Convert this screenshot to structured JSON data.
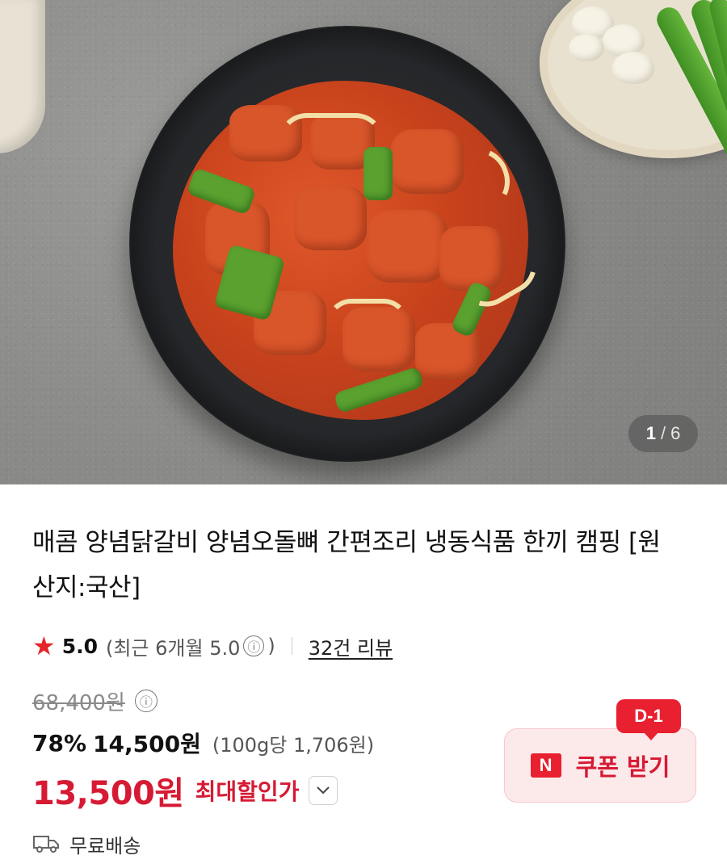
{
  "gallery": {
    "current": "1",
    "separator": "/",
    "total": "6",
    "image_alt": "매콤 양념닭갈비 음식 사진"
  },
  "product": {
    "title": "매콤 양념닭갈비 양념오돌뼈 간편조리 냉동식품 한끼 캠핑 [원산지:국산]"
  },
  "rating": {
    "star_icon": "star-icon",
    "score": "5.0",
    "recent_prefix": "(최근 6개월 5.0",
    "recent_suffix": ")",
    "info_icon": "ⓘ",
    "reviews_link": "32건 리뷰"
  },
  "price": {
    "original": "68,400원",
    "discount_percent": "78%",
    "sale_price": "14,500원",
    "unit_price": "(100g당 1,706원)",
    "max_discount_price": "13,500원",
    "max_discount_label": "최대할인가",
    "accent_color": "#d61a34"
  },
  "coupon": {
    "badge": "D-1",
    "logo": "N",
    "label": "쿠폰 받기"
  },
  "shipping": {
    "label": "무료배송",
    "icon": "truck-icon"
  }
}
